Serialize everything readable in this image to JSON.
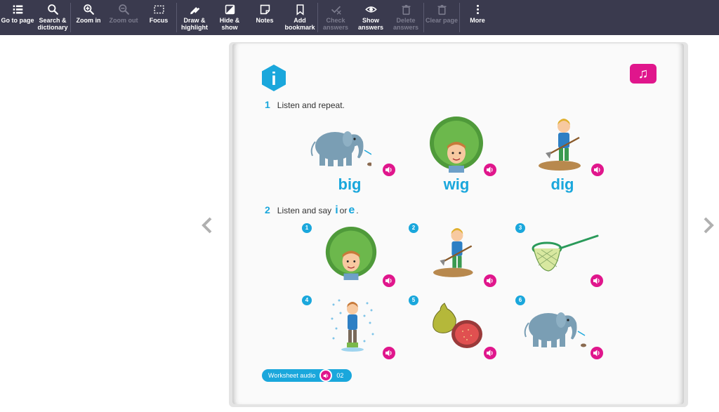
{
  "toolbar": {
    "items": [
      {
        "label": "Go to page",
        "icon": "list-icon",
        "enabled": true
      },
      {
        "label": "Search &\ndictionary",
        "icon": "search-icon",
        "enabled": true
      },
      {
        "label": "Zoom in",
        "icon": "zoom-in-icon",
        "enabled": true
      },
      {
        "label": "Zoom out",
        "icon": "zoom-out-icon",
        "enabled": false
      },
      {
        "label": "Focus",
        "icon": "focus-icon",
        "enabled": true
      },
      {
        "label": "Draw &\nhighlight",
        "icon": "pen-icon",
        "enabled": true
      },
      {
        "label": "Hide &\nshow",
        "icon": "hide-show-icon",
        "enabled": true
      },
      {
        "label": "Notes",
        "icon": "note-icon",
        "enabled": true
      },
      {
        "label": "Add\nbookmark",
        "icon": "bookmark-icon",
        "enabled": true
      },
      {
        "label": "Check\nanswers",
        "icon": "check-icon",
        "enabled": false
      },
      {
        "label": "Show\nanswers",
        "icon": "eye-icon",
        "enabled": true
      },
      {
        "label": "Delete\nanswers",
        "icon": "trash-icon",
        "enabled": false
      },
      {
        "label": "Clear page",
        "icon": "trash-icon",
        "enabled": false
      },
      {
        "label": "More",
        "icon": "more-vertical-icon",
        "enabled": true
      }
    ]
  },
  "page": {
    "badge_letter": "i",
    "music_icon": "♫",
    "exercise1": {
      "number": "1",
      "text": "Listen and repeat."
    },
    "words": [
      "big",
      "wig",
      "dig"
    ],
    "exercise2": {
      "number": "2",
      "text_before": "Listen and say",
      "letter_i": "i",
      "text_or": "or",
      "letter_e": "e",
      "text_after": "."
    },
    "item_numbers": [
      "1",
      "2",
      "3",
      "4",
      "5",
      "6"
    ],
    "worksheet_audio": {
      "label": "Worksheet audio",
      "number": "02"
    }
  },
  "colors": {
    "toolbar": "#3a3a4e",
    "accent_blue": "#1aa7dc",
    "accent_pink": "#e0168c"
  }
}
